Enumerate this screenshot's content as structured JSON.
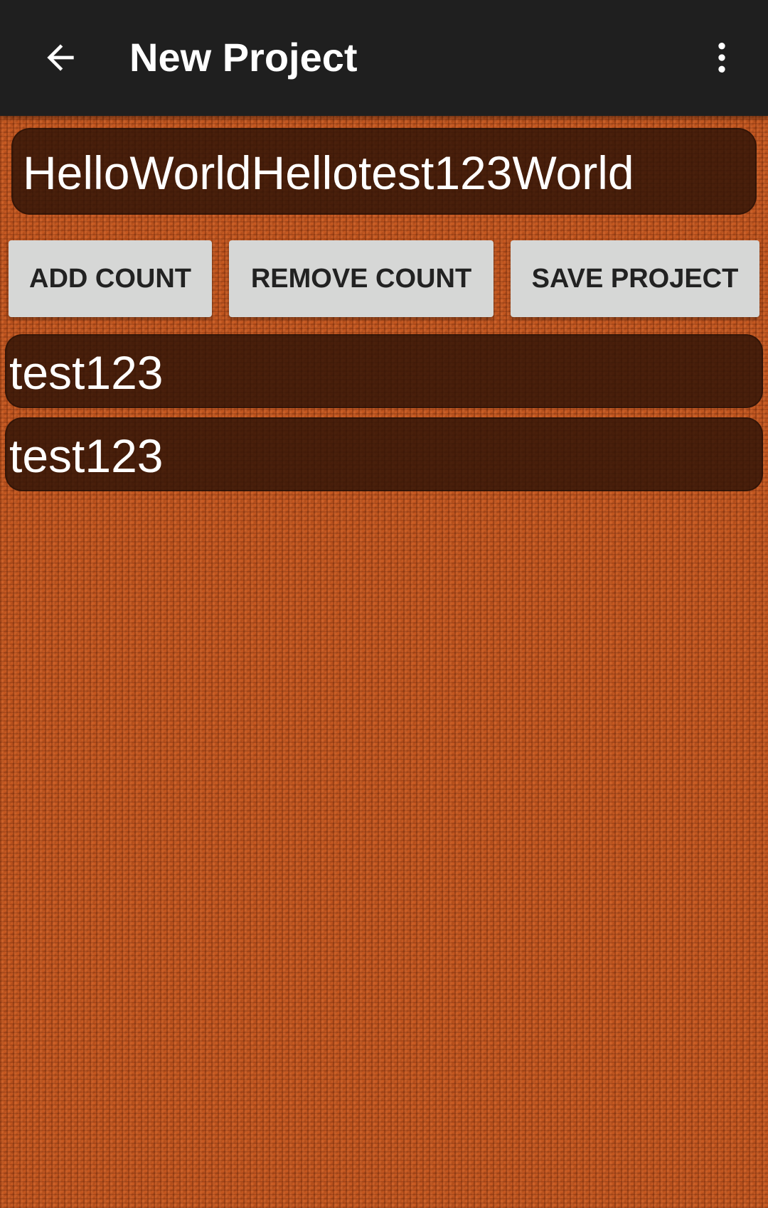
{
  "app_bar": {
    "title": "New Project",
    "back_icon": "arrow-back-icon",
    "menu_icon": "more-vert-icon",
    "background_color": "#1f1f1f"
  },
  "project": {
    "name_value": "HelloWorldHellotest123World"
  },
  "actions": {
    "add_count_label": "ADD COUNT",
    "remove_count_label": "REMOVE COUNT",
    "save_project_label": "SAVE PROJECT"
  },
  "counts": {
    "items": [
      {
        "label": "test123"
      },
      {
        "label": "test123"
      }
    ]
  },
  "colors": {
    "background": "#c2561f",
    "button": "#d6d7d6",
    "text_light": "#ffffff"
  }
}
